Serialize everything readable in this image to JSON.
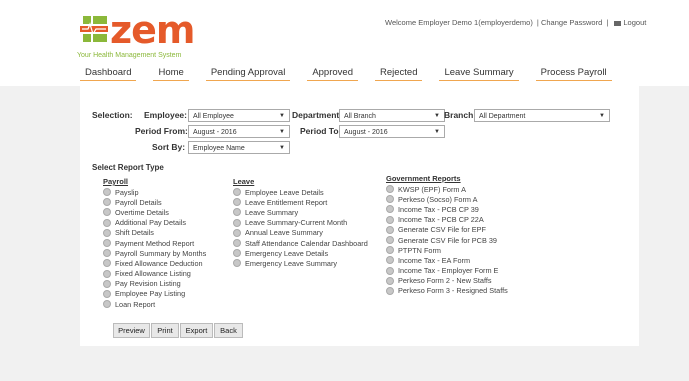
{
  "brand": {
    "logo_text": "zem",
    "tagline": "Your Health Management System",
    "colors": {
      "orange": "#e55a2a",
      "green": "#8bb83a",
      "nav_underline": "#f0a64f"
    }
  },
  "topbar": {
    "welcome": "Welcome Employer Demo 1(employerdemo)",
    "change_password": "Change Password",
    "logout": "Logout"
  },
  "nav": [
    "Dashboard",
    "Home",
    "Pending Approval",
    "Approved",
    "Rejected",
    "Leave Summary",
    "Process Payroll"
  ],
  "filters": {
    "selection_label": "Selection:",
    "employee_label": "Employee:",
    "employee_value": "All Employee",
    "department_label": "Department:",
    "department_value": "All Branch",
    "branch_label": "Branch:",
    "branch_value": "All Department",
    "period_from_label": "Period From:",
    "period_from_value": "August - 2016",
    "period_to_label": "Period To:",
    "period_to_value": "August - 2016",
    "sort_by_label": "Sort By:",
    "sort_by_value": "Employee Name"
  },
  "report_type_title": "Select Report Type",
  "payroll": {
    "title": "Payroll",
    "items": [
      "Payslip",
      "Payroll Details",
      "Overtime Details",
      "Additional Pay Details",
      "Shift Details",
      "Payment Method Report",
      "Payroll Summary by Months",
      "Fixed Allowance Deduction",
      "Fixed Allowance Listing",
      "Pay Revision Listing",
      "Employee Pay Listing",
      "Loan Report"
    ]
  },
  "leave": {
    "title": "Leave",
    "items": [
      "Employee Leave Details",
      "Leave Entitlement Report",
      "Leave Summary",
      "Leave Summary-Current Month",
      "Annual Leave Summary",
      "Staff Attendance Calendar Dashboard",
      "Emergency Leave Details",
      "Emergency Leave Summary"
    ]
  },
  "government": {
    "title": "Government Reports",
    "items": [
      "KWSP (EPF) Form A",
      "Perkeso (Socso) Form A",
      "Income Tax - PCB CP 39",
      "Income Tax - PCB CP 22A",
      "Generate CSV File for EPF",
      "Generate CSV File for PCB 39",
      "PTPTN Form",
      "Income Tax - EA Form",
      "Income Tax - Employer Form E",
      "Perkeso Form 2 - New Staffs",
      "Perkeso Form 3 - Resigned Staffs"
    ]
  },
  "buttons": {
    "preview": "Preview",
    "print": "Print",
    "export": "Export",
    "back": "Back"
  },
  "icons": {
    "logo": "zem-logo-icon",
    "logout": "logout-icon",
    "dropdown": "chevron-down-icon",
    "radio": "radio-icon"
  }
}
